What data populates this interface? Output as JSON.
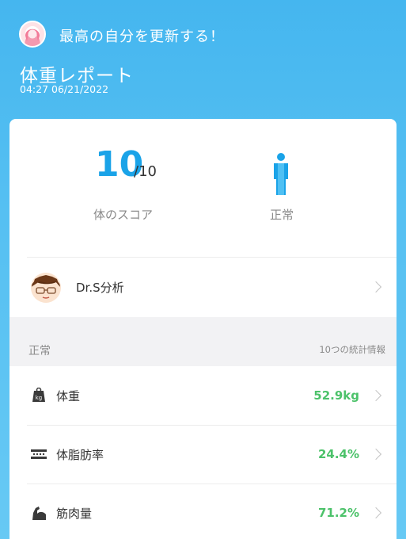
{
  "header": {
    "motto": "最高の自分を更新する！",
    "title": "体重レポート",
    "datetime": "04:27 06/21/2022"
  },
  "score": {
    "value": "10",
    "max": "/10",
    "label": "体のスコア",
    "body_status": "正常"
  },
  "doctor": {
    "label": "Dr.S分析"
  },
  "section": {
    "title": "正常",
    "count_label": "10つの統計情報"
  },
  "metrics": [
    {
      "label": "体重",
      "value": "52.9kg",
      "icon": "weight-scale-icon"
    },
    {
      "label": "体脂肪率",
      "value": "24.4%",
      "icon": "body-fat-icon"
    },
    {
      "label": "筋肉量",
      "value": "71.2%",
      "icon": "muscle-icon"
    }
  ],
  "colors": {
    "accent": "#1aa3e8",
    "good": "#4cc26a",
    "header_bg": "#45b6ef"
  }
}
